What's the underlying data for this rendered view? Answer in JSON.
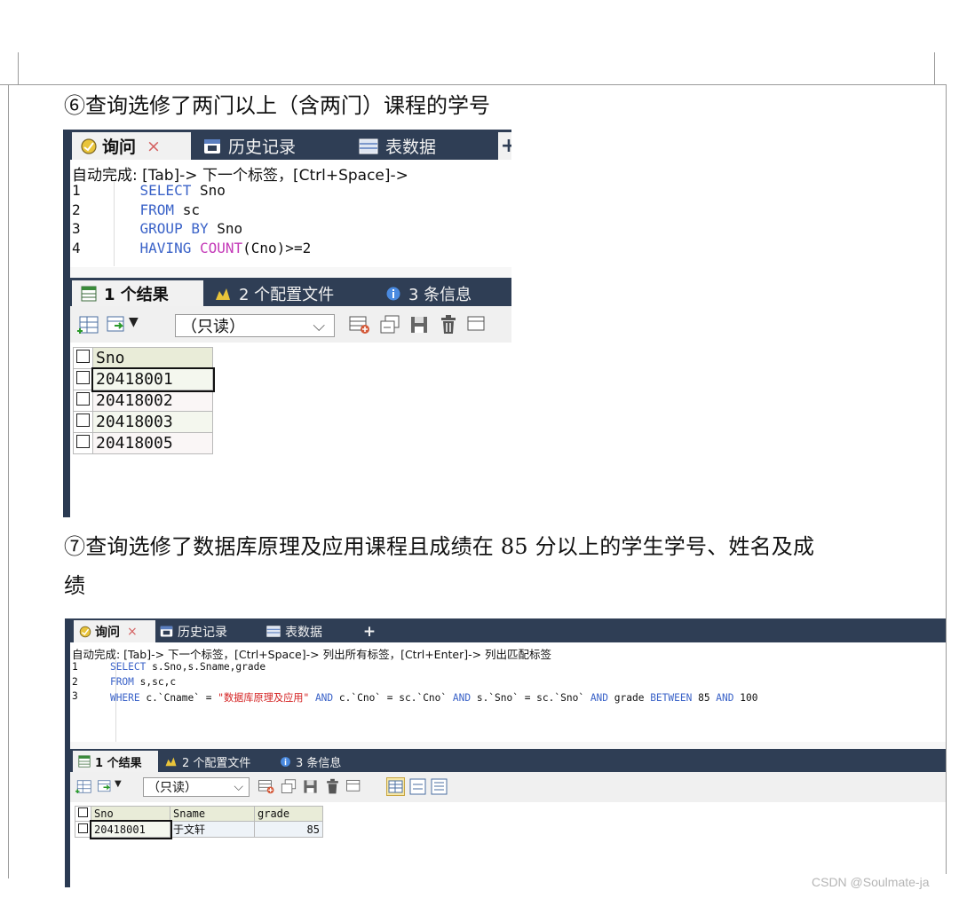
{
  "document": {
    "heading_6": "⑥查询选修了两门以上（含两门）课程的学号",
    "heading_7_line1": "⑦查询选修了数据库原理及应用课程且成绩在 85 分以上的学生学号、姓名及成",
    "heading_7_line2": "绩",
    "watermark": "CSDN @Soulmate-ja"
  },
  "shot1": {
    "tabs": [
      "询问",
      "历史记录",
      "表数据"
    ],
    "tab_close": "×",
    "tab_add": "+",
    "autocomplete": "自动完成: [Tab]-> 下一个标签，[Ctrl+Space]->",
    "lines": [
      {
        "n": "1",
        "parts": [
          {
            "t": "    "
          },
          {
            "t": "SELECT",
            "c": "kw"
          },
          {
            "t": " Sno"
          }
        ]
      },
      {
        "n": "2",
        "parts": [
          {
            "t": "    "
          },
          {
            "t": "FROM",
            "c": "kw"
          },
          {
            "t": " sc"
          }
        ]
      },
      {
        "n": "3",
        "parts": [
          {
            "t": "    "
          },
          {
            "t": "GROUP BY",
            "c": "kw"
          },
          {
            "t": " Sno"
          }
        ]
      },
      {
        "n": "4",
        "parts": [
          {
            "t": "    "
          },
          {
            "t": "HAVING",
            "c": "kw"
          },
          {
            "t": " "
          },
          {
            "t": "COUNT",
            "c": "fn"
          },
          {
            "t": "(Cno)>=2"
          }
        ]
      }
    ],
    "result_tabs": [
      "1 个结果",
      "2 个配置文件",
      "3 条信息"
    ],
    "combo": "（只读）",
    "combo_arrow": "⌵",
    "columns": [
      "Sno"
    ],
    "rows": [
      [
        "20418001"
      ],
      [
        "20418002"
      ],
      [
        "20418003"
      ],
      [
        "20418005"
      ]
    ]
  },
  "shot2": {
    "tabs": [
      "询问",
      "历史记录",
      "表数据"
    ],
    "tab_close": "×",
    "tab_add": "+",
    "autocomplete": "自动完成: [Tab]-> 下一个标签，[Ctrl+Space]-> 列出所有标签，[Ctrl+Enter]-> 列出匹配标签",
    "lines": [
      {
        "n": "1",
        "parts": [
          {
            "t": "    "
          },
          {
            "t": "SELECT",
            "c": "kw"
          },
          {
            "t": " s.Sno,s.Sname,grade"
          }
        ]
      },
      {
        "n": "2",
        "parts": [
          {
            "t": "    "
          },
          {
            "t": "FROM",
            "c": "kw"
          },
          {
            "t": " s,sc,c"
          }
        ]
      },
      {
        "n": "3",
        "parts": [
          {
            "t": "    "
          },
          {
            "t": "WHERE",
            "c": "kw"
          },
          {
            "t": " c.`Cname` = "
          },
          {
            "t": "\"数据库原理及应用\"",
            "c": "str"
          },
          {
            "t": " "
          },
          {
            "t": "AND",
            "c": "kw"
          },
          {
            "t": " c.`Cno` = sc.`Cno` "
          },
          {
            "t": "AND",
            "c": "kw"
          },
          {
            "t": " s.`Sno` = sc.`Sno` "
          },
          {
            "t": "AND",
            "c": "kw"
          },
          {
            "t": " grade "
          },
          {
            "t": "BETWEEN",
            "c": "kw"
          },
          {
            "t": " 85 "
          },
          {
            "t": "AND",
            "c": "kw"
          },
          {
            "t": " 100"
          }
        ]
      }
    ],
    "result_tabs": [
      "1 个结果",
      "2 个配置文件",
      "3 条信息"
    ],
    "combo": "（只读）",
    "combo_arrow": "⌵",
    "columns": [
      "Sno",
      "Sname",
      "grade"
    ],
    "rows": [
      [
        "20418001",
        "于文轩",
        "85"
      ]
    ]
  },
  "colors": {
    "tabbar": "#2f3e55",
    "keyword": "#3b63c8",
    "function": "#c43ab8",
    "string": "#d42020",
    "header_cell": "#e9ecd8"
  }
}
